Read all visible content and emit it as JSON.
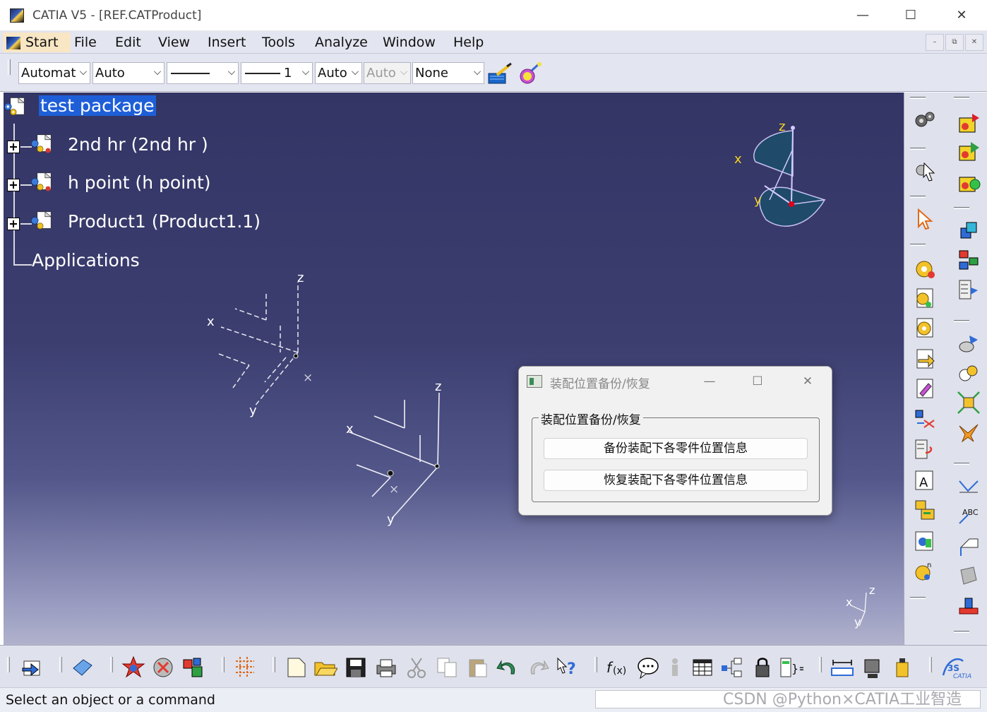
{
  "window": {
    "title": "CATIA V5 - [REF.CATProduct]",
    "minimize_glyph": "—",
    "maximize_glyph": "☐",
    "close_glyph": "✕"
  },
  "menu": {
    "items": [
      {
        "label": "Start"
      },
      {
        "label": "File"
      },
      {
        "label": "Edit"
      },
      {
        "label": "View"
      },
      {
        "label": "Insert"
      },
      {
        "label": "Tools"
      },
      {
        "label": "Analyze"
      },
      {
        "label": "Window"
      },
      {
        "label": "Help"
      }
    ],
    "mdi_minimize": "–",
    "mdi_restore": "⧉",
    "mdi_close": "✕"
  },
  "properties_toolbar": {
    "color_value": "Automat",
    "transparency_value": "Auto",
    "thickness_value": "1",
    "linetype_value": "Auto",
    "point_value": "Auto",
    "layer_value": "None"
  },
  "tree": {
    "root": "test package",
    "items": [
      {
        "label": "2nd hr  (2nd hr )"
      },
      {
        "label": "h point (h point)"
      },
      {
        "label": "Product1 (Product1.1)"
      }
    ],
    "applications": "Applications"
  },
  "axes": {
    "x": "x",
    "y": "y",
    "z": "z",
    "origin_mark": "×"
  },
  "dialog": {
    "title": "装配位置备份/恢复",
    "group_title": "装配位置备份/恢复",
    "backup_button": "备份装配下各零件位置信息",
    "restore_button": "恢复装配下各零件位置信息"
  },
  "status": {
    "text": "Select an object or a command"
  },
  "watermark": "CSDN @Python×CATIA工业智造",
  "colors": {
    "viewport_top": "#333565",
    "viewport_bottom": "#b0b2cc",
    "tree_selection": "#1e5fd8",
    "compass_fill": "#1f4a6a",
    "compass_label": "#f6d31f"
  }
}
